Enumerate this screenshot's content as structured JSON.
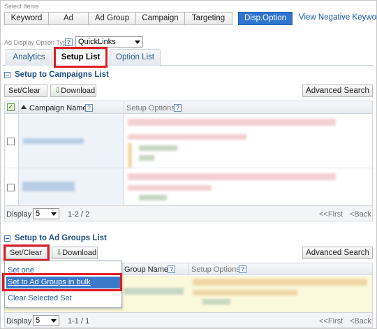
{
  "select_items_label": "Select Items",
  "segments": [
    "Keyword",
    "Ad",
    "Ad Group",
    "Campaign",
    "Targeting",
    "Disp.Option"
  ],
  "view_negative_link": "View Negative Keywor",
  "ad_display_label": "Ad Display Option Types",
  "ad_display_value": "QuickLinks",
  "help_icon_text": "?",
  "tabs": [
    "Analytics",
    "Setup List",
    "Option List"
  ],
  "campaigns_section": {
    "title": "Setup to Campaigns List",
    "set_clear": "Set/Clear",
    "download": "Download",
    "advanced_search": "Advanced Search",
    "col_campaign": "Campaign Name",
    "col_setup": "Setup Options",
    "display_label": "Display",
    "display_value": "5",
    "range": "1-2 / 2",
    "first": "<<First",
    "back": "<Back"
  },
  "adgroups_section": {
    "title": "Setup to Ad Groups List",
    "set_clear": "Set/Clear",
    "download": "Download",
    "advanced_search": "Advanced Search",
    "col_group": "Group Name",
    "col_setup": "Setup Options",
    "display_label": "Display",
    "display_value": "5",
    "range": "1-1 / 1",
    "first": "<<First",
    "back": "<Back"
  },
  "menu": {
    "set_one": "Set one",
    "set_bulk": "Set to Ad Groups in bulk",
    "clear": "Clear Selected Set"
  },
  "colors": {
    "accent": "#2f75cd",
    "highlight": "#e01b24",
    "section_title": "#1f4f8a"
  }
}
